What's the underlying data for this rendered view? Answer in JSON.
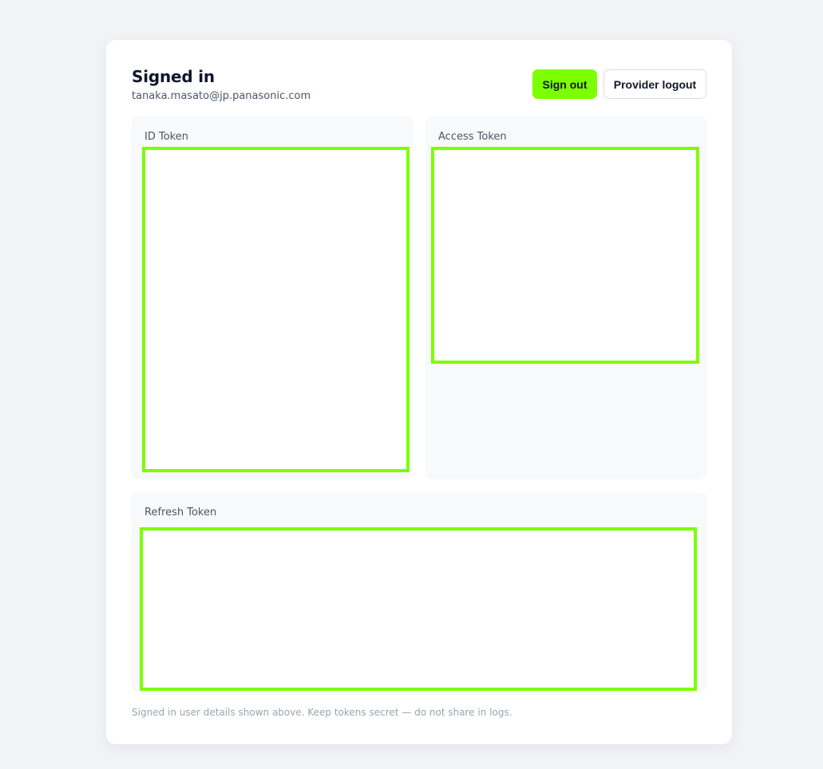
{
  "header": {
    "title": "Signed in",
    "email": "tanaka.masato@jp.panasonic.com"
  },
  "actions": {
    "sign_out_label": "Sign out",
    "provider_logout_label": "Provider logout"
  },
  "tokens": {
    "id_token": {
      "label": "ID Token",
      "value": ""
    },
    "access_token": {
      "label": "Access Token",
      "value": ""
    },
    "refresh_token": {
      "label": "Refresh Token",
      "value": ""
    }
  },
  "footer": {
    "note": "Signed in user details shown above. Keep tokens secret — do not share in logs."
  },
  "colors": {
    "accent": "#7cff00",
    "page_background": "#f2f3f5",
    "card_background": "#ffffff",
    "panel_background": "#f8f9fb"
  }
}
